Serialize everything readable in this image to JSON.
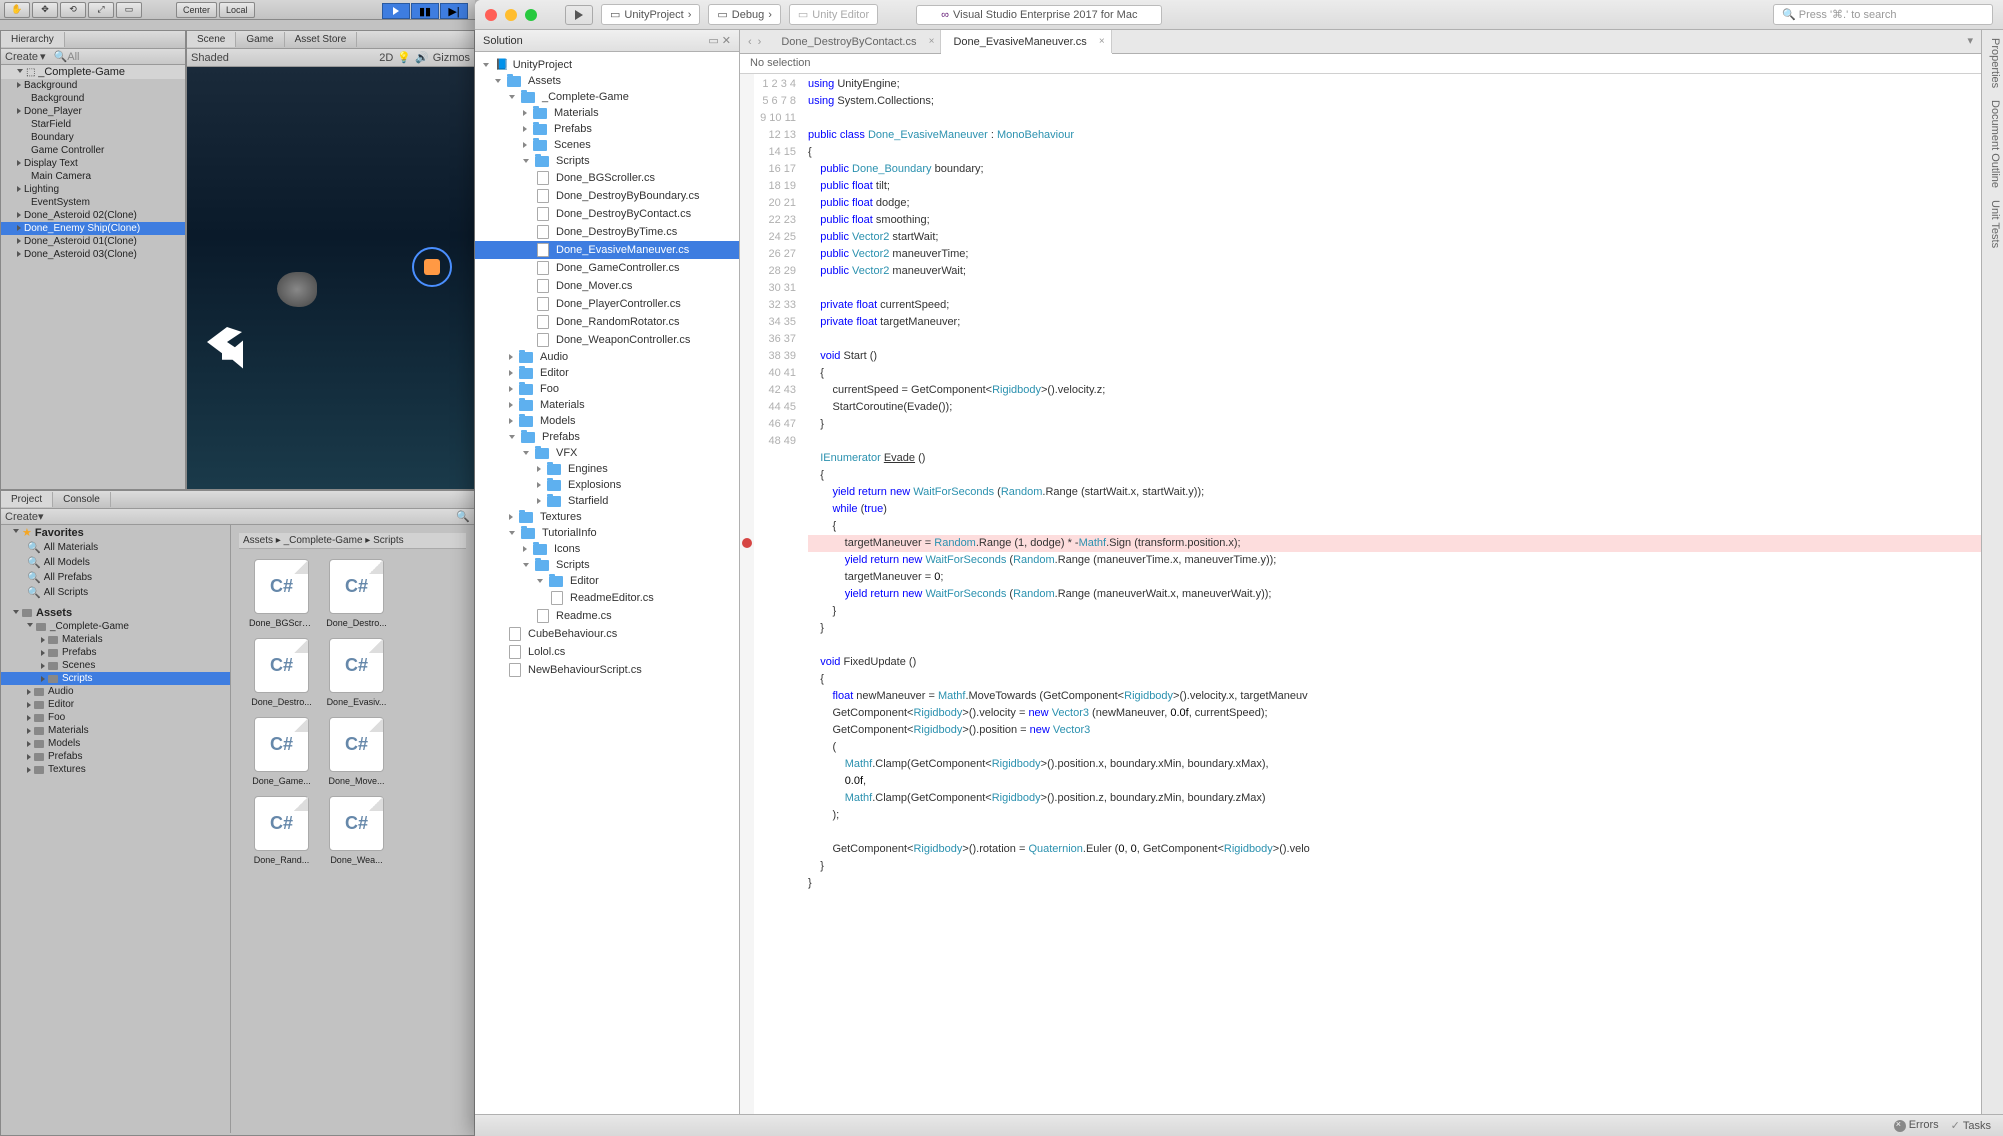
{
  "unity": {
    "toolbar": {
      "center": "Center",
      "local": "Local"
    },
    "hierarchy": {
      "title": "Hierarchy",
      "create": "Create",
      "search": "All",
      "scene": "_Complete-Game",
      "items": [
        {
          "label": "Background",
          "depth": 0,
          "open": true
        },
        {
          "label": "Background",
          "depth": 1
        },
        {
          "label": "Done_Player",
          "depth": 0
        },
        {
          "label": "StarField",
          "depth": 1
        },
        {
          "label": "Boundary",
          "depth": 1
        },
        {
          "label": "Game Controller",
          "depth": 1
        },
        {
          "label": "Display Text",
          "depth": 0
        },
        {
          "label": "Main Camera",
          "depth": 1
        },
        {
          "label": "Lighting",
          "depth": 0
        },
        {
          "label": "EventSystem",
          "depth": 1
        },
        {
          "label": "Done_Asteroid 02(Clone)",
          "depth": 0
        },
        {
          "label": "Done_Enemy Ship(Clone)",
          "depth": 0,
          "sel": true
        },
        {
          "label": "Done_Asteroid 01(Clone)",
          "depth": 0
        },
        {
          "label": "Done_Asteroid 03(Clone)",
          "depth": 0
        }
      ]
    },
    "scene": {
      "tabs": [
        "Scene",
        "Game",
        "Asset Store"
      ],
      "opts": [
        "Shaded",
        "2D",
        "Gizmos"
      ]
    },
    "project": {
      "tabs": [
        "Project",
        "Console"
      ],
      "create": "Create",
      "favorites": "Favorites",
      "fav_items": [
        "All Materials",
        "All Models",
        "All Prefabs",
        "All Scripts"
      ],
      "assets": "Assets",
      "tree": [
        {
          "l": "_Complete-Game",
          "d": 1,
          "open": true
        },
        {
          "l": "Materials",
          "d": 2
        },
        {
          "l": "Prefabs",
          "d": 2
        },
        {
          "l": "Scenes",
          "d": 2
        },
        {
          "l": "Scripts",
          "d": 2,
          "sel": true
        },
        {
          "l": "Audio",
          "d": 1
        },
        {
          "l": "Editor",
          "d": 1
        },
        {
          "l": "Foo",
          "d": 1
        },
        {
          "l": "Materials",
          "d": 1
        },
        {
          "l": "Models",
          "d": 1
        },
        {
          "l": "Prefabs",
          "d": 1
        },
        {
          "l": "Textures",
          "d": 1
        }
      ],
      "crumb": "Assets ▸ _Complete-Game ▸ Scripts",
      "grid": [
        "Done_BGScro...",
        "Done_Destro...",
        "Done_Destro...",
        "Done_Evasiv...",
        "Done_Game...",
        "Done_Move...",
        "Done_Rand...",
        "Done_Wea..."
      ]
    }
  },
  "vs": {
    "breadcrumb": [
      "UnityProject",
      "Debug",
      "Unity Editor"
    ],
    "title": "Visual Studio Enterprise 2017 for Mac",
    "search_ph": "Press '⌘.' to search",
    "solution": {
      "title": "Solution",
      "root": "UnityProject",
      "assets": "Assets",
      "tree": [
        {
          "l": "_Complete-Game",
          "d": 2,
          "f": true,
          "o": true
        },
        {
          "l": "Materials",
          "d": 3,
          "f": true
        },
        {
          "l": "Prefabs",
          "d": 3,
          "f": true,
          "c": true
        },
        {
          "l": "Scenes",
          "d": 3,
          "f": true
        },
        {
          "l": "Scripts",
          "d": 3,
          "f": true,
          "o": true
        },
        {
          "l": "Done_BGScroller.cs",
          "d": 4
        },
        {
          "l": "Done_DestroyByBoundary.cs",
          "d": 4
        },
        {
          "l": "Done_DestroyByContact.cs",
          "d": 4
        },
        {
          "l": "Done_DestroyByTime.cs",
          "d": 4
        },
        {
          "l": "Done_EvasiveManeuver.cs",
          "d": 4,
          "sel": true
        },
        {
          "l": "Done_GameController.cs",
          "d": 4
        },
        {
          "l": "Done_Mover.cs",
          "d": 4
        },
        {
          "l": "Done_PlayerController.cs",
          "d": 4
        },
        {
          "l": "Done_RandomRotator.cs",
          "d": 4
        },
        {
          "l": "Done_WeaponController.cs",
          "d": 4
        },
        {
          "l": "Audio",
          "d": 2,
          "f": true
        },
        {
          "l": "Editor",
          "d": 2,
          "f": true,
          "c": true
        },
        {
          "l": "Foo",
          "d": 2,
          "f": true,
          "c": true
        },
        {
          "l": "Materials",
          "d": 2,
          "f": true
        },
        {
          "l": "Models",
          "d": 2,
          "f": true
        },
        {
          "l": "Prefabs",
          "d": 2,
          "f": true,
          "o": true
        },
        {
          "l": "VFX",
          "d": 3,
          "f": true,
          "o": true
        },
        {
          "l": "Engines",
          "d": 4,
          "f": true
        },
        {
          "l": "Explosions",
          "d": 4,
          "f": true
        },
        {
          "l": "Starfield",
          "d": 4,
          "f": true
        },
        {
          "l": "Textures",
          "d": 2,
          "f": true
        },
        {
          "l": "TutorialInfo",
          "d": 2,
          "f": true,
          "o": true
        },
        {
          "l": "Icons",
          "d": 3,
          "f": true
        },
        {
          "l": "Scripts",
          "d": 3,
          "f": true,
          "o": true
        },
        {
          "l": "Editor",
          "d": 4,
          "f": true,
          "o": true
        },
        {
          "l": "ReadmeEditor.cs",
          "d": 5
        },
        {
          "l": "Readme.cs",
          "d": 4
        },
        {
          "l": "CubeBehaviour.cs",
          "d": 2
        },
        {
          "l": "Lolol.cs",
          "d": 2
        },
        {
          "l": "NewBehaviourScript.cs",
          "d": 2
        }
      ]
    },
    "tabs": [
      {
        "l": "Done_DestroyByContact.cs"
      },
      {
        "l": "Done_EvasiveManeuver.cs",
        "act": true
      }
    ],
    "crumb2": "No selection",
    "sidebar": [
      "Properties",
      "Document Outline",
      "Unit Tests"
    ],
    "status": {
      "errors": "Errors",
      "tasks": "Tasks"
    }
  }
}
